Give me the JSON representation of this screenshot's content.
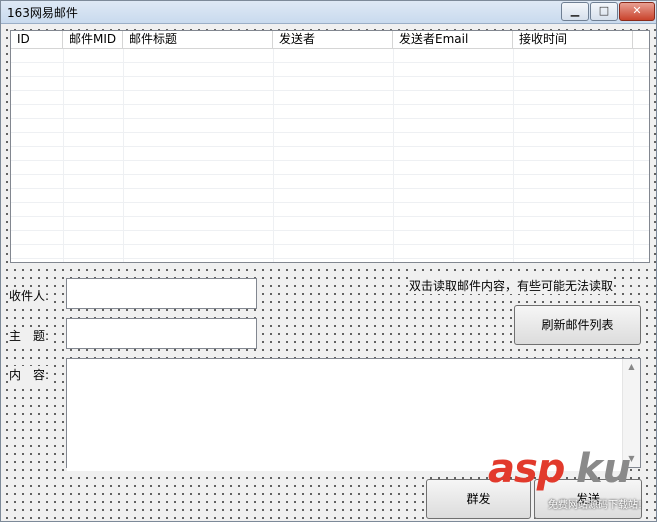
{
  "window": {
    "title": "163网易邮件",
    "minimize_glyph": "▁",
    "maximize_glyph": "□",
    "close_glyph": "✕"
  },
  "mail_list": {
    "columns": [
      {
        "label": "ID"
      },
      {
        "label": "邮件MID"
      },
      {
        "label": "邮件标题"
      },
      {
        "label": "发送者"
      },
      {
        "label": "发送者Email"
      },
      {
        "label": "接收时间"
      }
    ]
  },
  "form": {
    "recipient_label": "收件人:",
    "recipient_value": "",
    "subject_label": "主　题:",
    "subject_value": "",
    "content_label": "内　容:",
    "content_value": ""
  },
  "hint": "双击读取邮件内容，有些可能无法读取",
  "buttons": {
    "refresh": "刷新邮件列表",
    "group_send": "群发",
    "send": "发送"
  },
  "watermark": {
    "brand_a": "asp",
    "brand_b": "ku",
    "tagline": "免费网站源码下载站!"
  },
  "icons": {
    "scroll_up": "▲",
    "scroll_down": "▼"
  }
}
